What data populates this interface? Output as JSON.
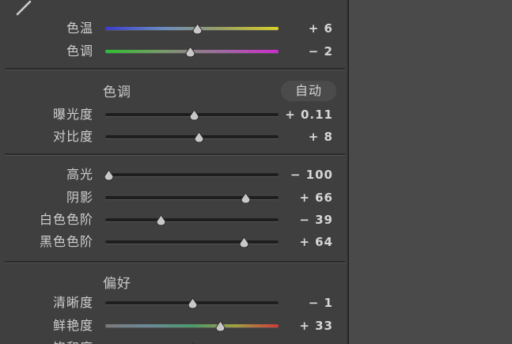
{
  "white_balance": {
    "rows": [
      {
        "label": "色温",
        "value": "+ 6",
        "pos": 0.53,
        "gradient": "linear-gradient(90deg,#3a3ad0,#6a8cc0,#9aa060,#d8d02a)"
      },
      {
        "label": "色调",
        "value": "− 2",
        "pos": 0.49,
        "gradient": "linear-gradient(90deg,#2cc032,#7a9a6a,#a06aa0,#d02ad0)"
      }
    ]
  },
  "tone": {
    "title": "色调",
    "auto_label": "自动",
    "rows": [
      {
        "label": "曝光度",
        "value": "+ 0.11",
        "pos": 0.51
      },
      {
        "label": "对比度",
        "value": "+ 8",
        "pos": 0.54
      }
    ]
  },
  "tone2": {
    "rows": [
      {
        "label": "高光",
        "value": "− 100",
        "pos": 0.02
      },
      {
        "label": "阴影",
        "value": "+ 66",
        "pos": 0.81
      },
      {
        "label": "白色色阶",
        "value": "− 39",
        "pos": 0.32
      },
      {
        "label": "黑色色阶",
        "value": "+ 64",
        "pos": 0.8
      }
    ]
  },
  "presence": {
    "title": "偏好",
    "rows": [
      {
        "label": "清晰度",
        "value": "− 1",
        "pos": 0.5
      },
      {
        "label": "鲜艳度",
        "value": "+ 33",
        "pos": 0.66,
        "gradient": "linear-gradient(90deg,#7a7a7a,#6a8a9a,#4a9a6a,#a0a040,#d03a3a)"
      },
      {
        "label": "饱和度",
        "value": "",
        "pos": 0.5
      }
    ]
  },
  "colors": {
    "panel_bg": "#3f3f3f",
    "page_bg": "#4a4a4a",
    "track": "#1e1e1e",
    "thumb": "#c8c8c8"
  }
}
